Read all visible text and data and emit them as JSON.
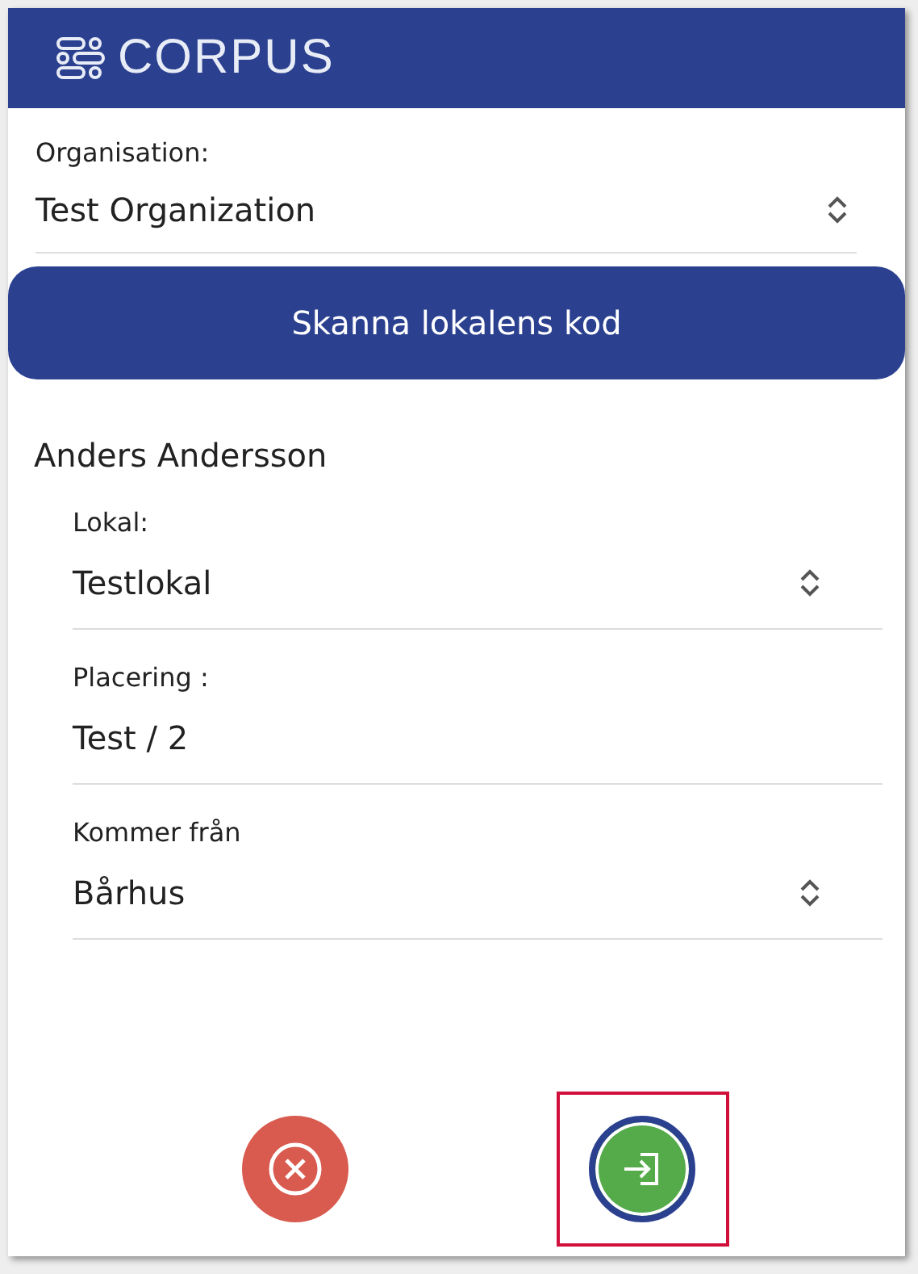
{
  "header": {
    "brand": "CORPUS"
  },
  "organisation": {
    "label": "Organisation:",
    "value": "Test Organization",
    "kind": "select"
  },
  "scan_button": {
    "label": "Skanna lokalens kod"
  },
  "person": {
    "name": "Anders Andersson"
  },
  "fields": [
    {
      "label": "Lokal:",
      "value": "Testlokal",
      "kind": "select"
    },
    {
      "label": "Placering :",
      "value": "Test / 2",
      "kind": "text"
    },
    {
      "label": "Kommer från",
      "value": "Bårhus",
      "kind": "select"
    }
  ],
  "actions": [
    {
      "kind": "cancel",
      "highlighted": false
    },
    {
      "kind": "confirm",
      "highlighted": true
    }
  ]
}
